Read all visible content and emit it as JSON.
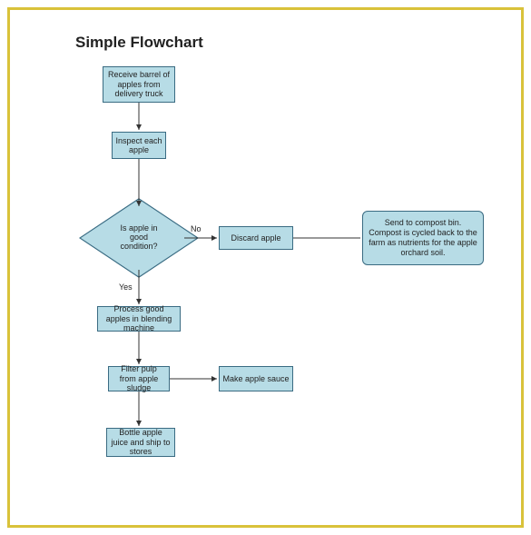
{
  "title": "Simple Flowchart",
  "nodes": {
    "receive": "Receive barrel of apples from delivery truck",
    "inspect": "Inspect each apple",
    "decision": "Is apple in good condition?",
    "discard": "Discard apple",
    "compost": "Send to compost bin. Compost is cycled back to the farm as nutrients for the apple orchard soil.",
    "process": "Process good apples in blending machine",
    "filter": "Filter pulp from apple sludge",
    "sauce": "Make apple sauce",
    "bottle": "Bottle apple juice and ship to stores"
  },
  "edge_labels": {
    "no": "No",
    "yes": "Yes"
  }
}
